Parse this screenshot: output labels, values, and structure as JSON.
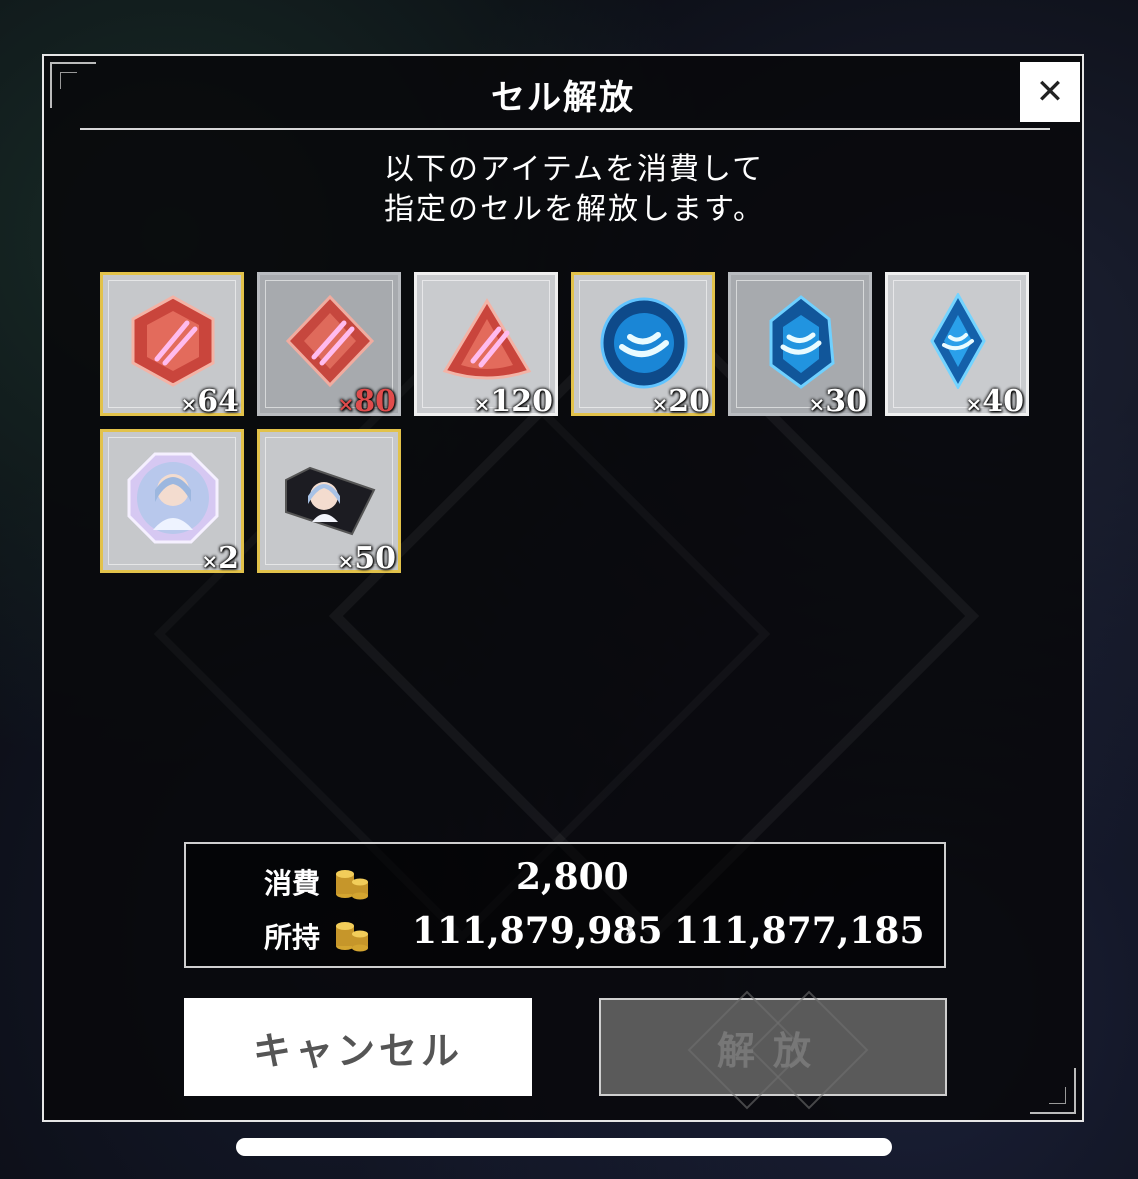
{
  "dialog": {
    "title": "セル解放",
    "close_label": "✕",
    "description_line1": "以下のアイテムを消費して",
    "description_line2": "指定のセルを解放します。"
  },
  "items": [
    {
      "icon": "red-hexagon-gem-icon",
      "quantity": "64",
      "frame": "gold"
    },
    {
      "icon": "red-diamond-gem-icon",
      "quantity": "80",
      "frame": "silver",
      "insufficient": true
    },
    {
      "icon": "red-triangle-gem-icon",
      "quantity": "120",
      "frame": "white"
    },
    {
      "icon": "blue-round-crystal-icon",
      "quantity": "20",
      "frame": "gold"
    },
    {
      "icon": "blue-oval-crystal-icon",
      "quantity": "30",
      "frame": "silver"
    },
    {
      "icon": "blue-shard-crystal-icon",
      "quantity": "40",
      "frame": "white"
    },
    {
      "icon": "character-portrait-medal-icon",
      "quantity": "2",
      "frame": "gold"
    },
    {
      "icon": "character-portrait-ticket-icon",
      "quantity": "50",
      "frame": "gold"
    }
  ],
  "cost": {
    "consume_label": "消費",
    "consume_value": "2,800",
    "owned_label": "所持",
    "owned_before": "111,879,985",
    "owned_arrow": "›",
    "owned_after": "111,877,185",
    "currency_icon": "gold-coin-stack-icon"
  },
  "buttons": {
    "cancel_label": "キャンセル",
    "release_label": "解放"
  },
  "colors": {
    "gold_frame": "#e2c24a",
    "insufficient_red": "#e04c4c",
    "disabled_button": "#5a5a5a"
  }
}
